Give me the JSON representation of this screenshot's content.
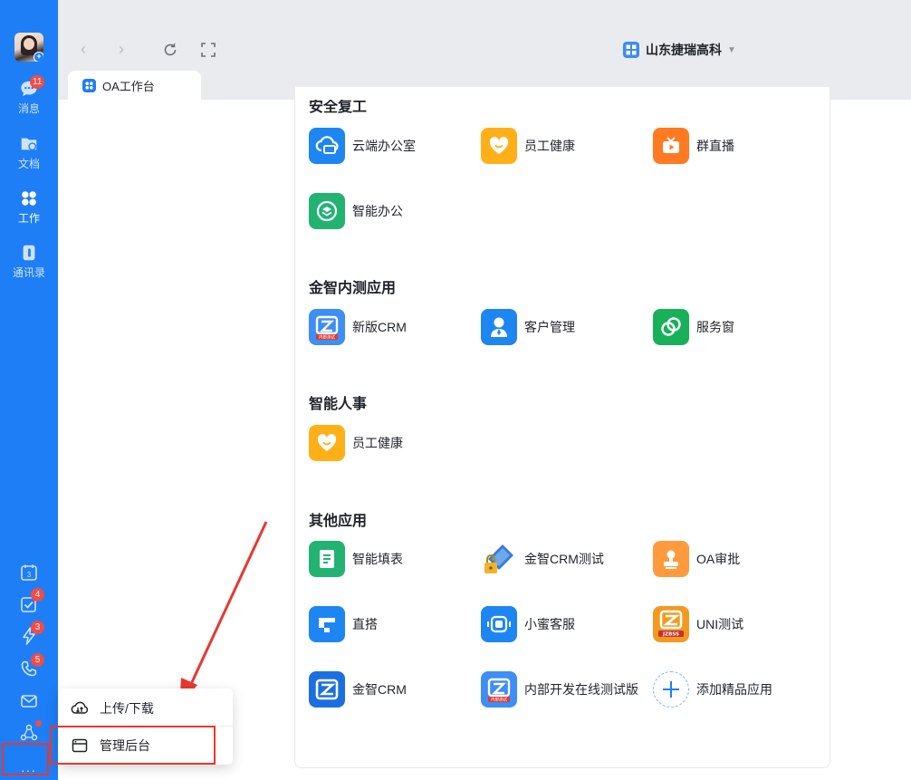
{
  "sidebar": {
    "items": [
      {
        "label": "消息",
        "badge": "11"
      },
      {
        "label": "文档"
      },
      {
        "label": "工作"
      },
      {
        "label": "通讯录"
      }
    ],
    "tools": [
      {
        "icon": "calendar-icon",
        "badge": ""
      },
      {
        "icon": "todo-check-icon",
        "badge": "4"
      },
      {
        "icon": "lightning-icon",
        "badge": "3"
      },
      {
        "icon": "phone-icon",
        "badge": "5"
      },
      {
        "icon": "mail-icon",
        "badge": ""
      },
      {
        "icon": "apps-hub-icon",
        "badge": ""
      }
    ],
    "more": "···",
    "calendar_day": "3",
    "accent": "#1e7ef6"
  },
  "toolbar": {
    "org_name": "山东捷瑞高科",
    "tab_label": "OA工作台"
  },
  "sections": [
    {
      "title": "安全复工",
      "apps": [
        "云端办公室",
        "员工健康",
        "群直播",
        "智能办公"
      ]
    },
    {
      "title": "金智内测应用",
      "apps": [
        "新版CRM",
        "客户管理",
        "服务窗"
      ]
    },
    {
      "title": "智能人事",
      "apps": [
        "员工健康"
      ]
    },
    {
      "title": "其他应用",
      "apps": [
        "智能填表",
        "金智CRM测试",
        "OA审批",
        "直搭",
        "小蜜客服",
        "UNI测试",
        "金智CRM",
        "内部开发在线测试版",
        "添加精品应用"
      ]
    }
  ],
  "icon_texts": {
    "crm_tag": "内部测试",
    "uni_tag": "JZBSS"
  },
  "popup": {
    "items": [
      {
        "label": "上传/下载"
      },
      {
        "label": "管理后台"
      }
    ]
  }
}
